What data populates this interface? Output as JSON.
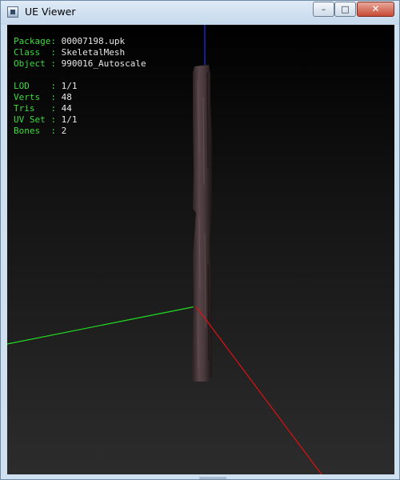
{
  "window": {
    "title": "UE Viewer",
    "buttons": {
      "minimize": "–",
      "maximize": "□",
      "close": "✕"
    }
  },
  "info": {
    "package_label": "Package: ",
    "package_value": "00007198.upk",
    "class_label": "Class  : ",
    "class_value": "SkeletalMesh",
    "object_label": "Object : ",
    "object_value": "990016_Autoscale",
    "lod_label": "LOD    : ",
    "lod_value": "1/1",
    "verts_label": "Verts  : ",
    "verts_value": "48",
    "tris_label": "Tris   : ",
    "tris_value": "44",
    "uvset_label": "UV Set : ",
    "uvset_value": "1/1",
    "bones_label": "Bones  : ",
    "bones_value": "2"
  },
  "colors": {
    "axis_x": "#e01010",
    "axis_y": "#22dd22",
    "axis_z": "#2030ff",
    "label": "#3ddc3d",
    "value": "#e8e8e8"
  }
}
